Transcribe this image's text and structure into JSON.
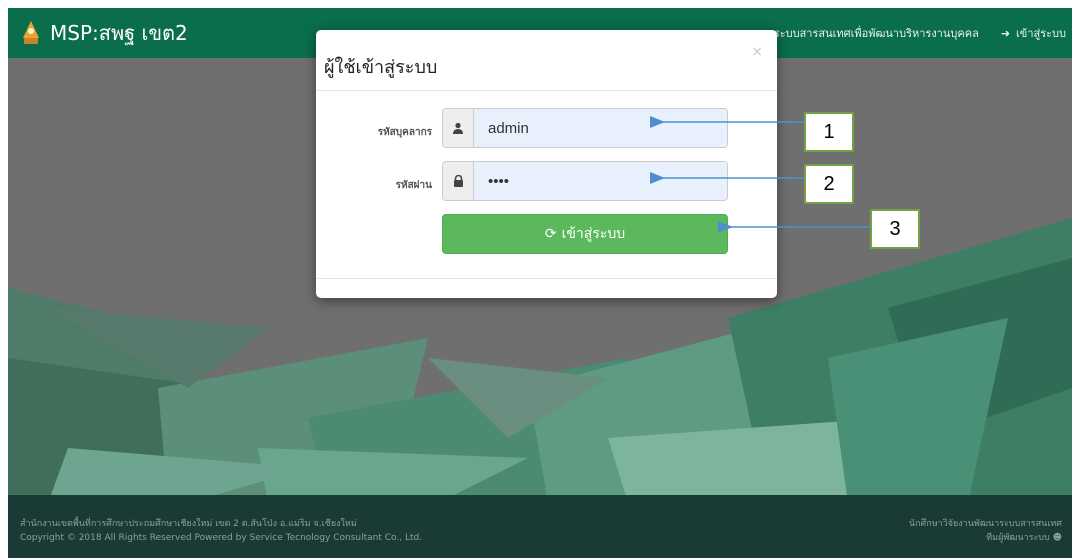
{
  "navbar": {
    "brand": "MSP:สพฐ เขต2",
    "link_system": "ระบบสารสนเทศเพื่อพัฒนาบริหารงานบุคคล",
    "link_login": "เข้าสู่ระบบ"
  },
  "modal": {
    "title": "ผู้ใช้เข้าสู่ระบบ",
    "close_symbol": "×",
    "username_label": "รหัสบุคลากร",
    "username_value": "admin",
    "password_label": "รหัสผ่าน",
    "password_value": "••••",
    "login_button": "เข้าสู่ระบบ"
  },
  "footer": {
    "left_line1": "สำนักงานเขตพื้นที่การศึกษาประถมศึกษาเชียงใหม่ เขต 2 ต.สันโป่ง อ.แม่ริม จ.เชียงใหม่",
    "left_line2": "Copyright © 2018 All Rights Reserved Powered by Service Tecnology Consultant Co., Ltd.",
    "right_line1": "นักศึกษาวิจัยงานพัฒนาระบบสารสนเทศ",
    "right_line2": "ทีมผู้พัฒนาระบบ"
  },
  "callouts": [
    "1",
    "2",
    "3"
  ],
  "colors": {
    "navbar": "#0a6d4c",
    "button": "#5cb85c",
    "callout_border": "#72a343",
    "arrow": "#4f8fcf"
  }
}
